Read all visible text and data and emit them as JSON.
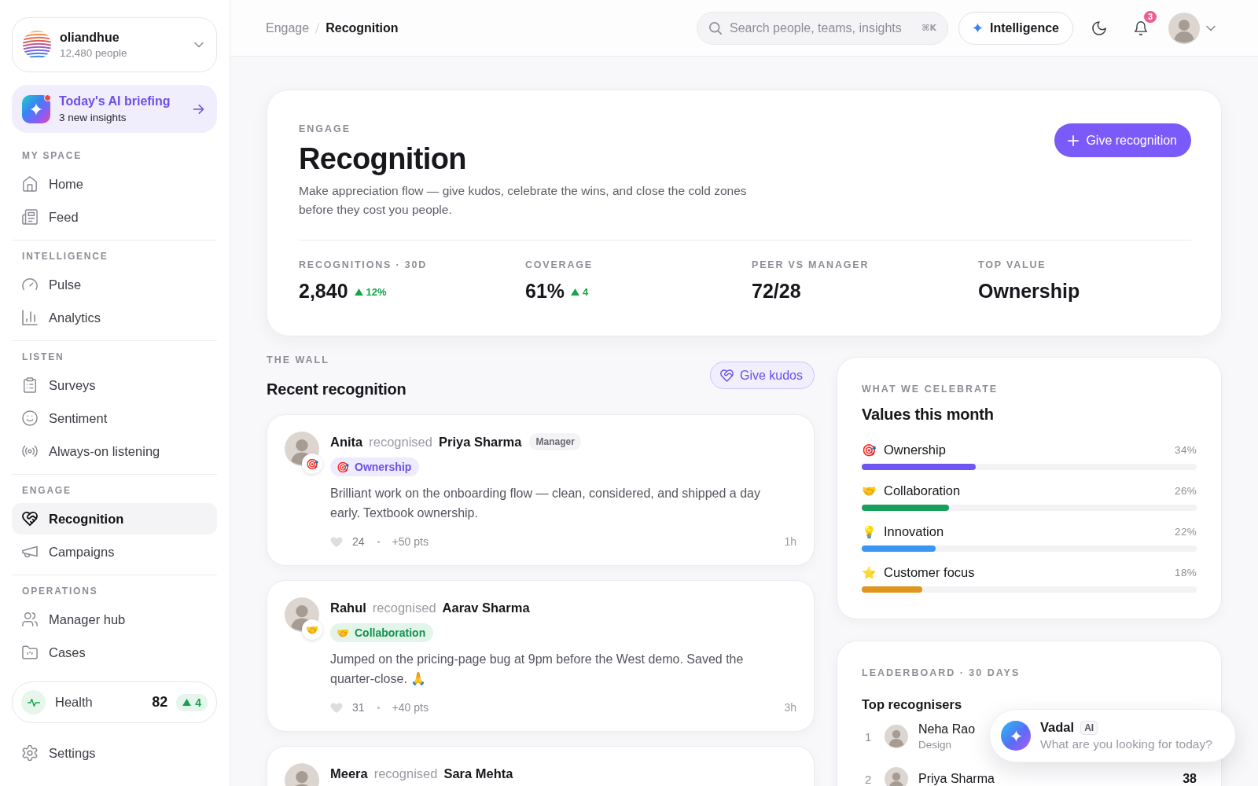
{
  "sidebar": {
    "org": {
      "name": "oliandhue",
      "members": "12,480 people"
    },
    "briefing": {
      "title": "Today's AI briefing",
      "subtitle": "3 new insights",
      "unread": true
    },
    "sections": [
      {
        "label": "MY SPACE",
        "items": [
          {
            "label": "Home",
            "selected": false
          },
          {
            "label": "Feed",
            "selected": false
          }
        ]
      },
      {
        "label": "INTELLIGENCE",
        "items": [
          {
            "label": "Pulse",
            "selected": false
          },
          {
            "label": "Analytics",
            "selected": false
          }
        ]
      },
      {
        "label": "LISTEN",
        "items": [
          {
            "label": "Surveys",
            "selected": false
          },
          {
            "label": "Sentiment",
            "selected": false
          },
          {
            "label": "Always-on listening",
            "selected": false
          }
        ]
      },
      {
        "label": "ENGAGE",
        "items": [
          {
            "label": "Recognition",
            "selected": true
          },
          {
            "label": "Campaigns",
            "selected": false
          }
        ]
      },
      {
        "label": "OPERATIONS",
        "items": [
          {
            "label": "Manager hub",
            "selected": false
          },
          {
            "label": "Cases",
            "selected": false
          }
        ]
      }
    ],
    "health": {
      "label": "Health",
      "score": "82",
      "delta": "4"
    },
    "settings": {
      "label": "Settings"
    }
  },
  "header": {
    "breadcrumb": [
      {
        "label": "Engage",
        "current": false
      },
      {
        "label": "Recognition",
        "current": true
      }
    ],
    "search": {
      "placeholder": "Search people, teams, insights",
      "shortcut": "⌘K"
    },
    "intelligence": {
      "label": "Intelligence"
    },
    "notifications": {
      "count": "3"
    }
  },
  "hero": {
    "eyebrow": "ENGAGE",
    "title": "Recognition",
    "description": "Make appreciation flow — give kudos, celebrate the wins, and close the cold zones before they cost you people.",
    "action": "Give recognition",
    "stats": [
      {
        "label": "RECOGNITIONS · 30D",
        "value": "2,840",
        "delta": "12%"
      },
      {
        "label": "COVERAGE",
        "value": "61%",
        "delta": "4"
      },
      {
        "label": "PEER VS MANAGER",
        "value": "72/28"
      },
      {
        "label": "TOP VALUE",
        "value": "Ownership"
      }
    ]
  },
  "wall": {
    "eyebrow": "THE WALL",
    "title": "Recent recognition",
    "action": "Give kudos",
    "posts": [
      {
        "from": "Anita",
        "verb": "recognised",
        "to": "Priya Sharma",
        "role": "Manager",
        "badge": "🎯",
        "value": {
          "emoji": "🎯",
          "label": "Ownership",
          "kind": "ownership"
        },
        "message": "Brilliant work on the onboarding flow — clean, considered, and shipped a day early. Textbook ownership.",
        "likes": "24",
        "points": "+50 pts",
        "time": "1h"
      },
      {
        "from": "Rahul",
        "verb": "recognised",
        "to": "Aarav Sharma",
        "badge": "🤝",
        "value": {
          "emoji": "🤝",
          "label": "Collaboration",
          "kind": "collaboration"
        },
        "message": "Jumped on the pricing-page bug at 9pm before the West demo. Saved the quarter-close. 🙏",
        "likes": "31",
        "points": "+40 pts",
        "time": "3h"
      },
      {
        "from": "Meera",
        "verb": "recognised",
        "to": "Sara Mehta"
      }
    ]
  },
  "values": {
    "eyebrow": "WHAT WE CELEBRATE",
    "title": "Values this month",
    "items": [
      {
        "emoji": "🎯",
        "label": "Ownership",
        "percent": "34%",
        "level": 0.34,
        "color": "#6e56f0"
      },
      {
        "emoji": "🤝",
        "label": "Collaboration",
        "percent": "26%",
        "level": 0.26,
        "color": "#16a05a"
      },
      {
        "emoji": "💡",
        "label": "Innovation",
        "percent": "22%",
        "level": 0.22,
        "color": "#3b95f5"
      },
      {
        "emoji": "⭐",
        "label": "Customer focus",
        "percent": "18%",
        "level": 0.18,
        "color": "#e0951e"
      }
    ]
  },
  "leaderboard": {
    "eyebrow": "LEADERBOARD · 30 DAYS",
    "title": "Top recognisers",
    "rows": [
      {
        "rank": "1",
        "name": "Neha Rao",
        "team": "Design"
      },
      {
        "rank": "2",
        "name": "Priya Sharma",
        "count": "38"
      }
    ]
  },
  "assistant": {
    "name": "Vadal",
    "tag": "AI",
    "prompt": "What are you looking for today?"
  }
}
